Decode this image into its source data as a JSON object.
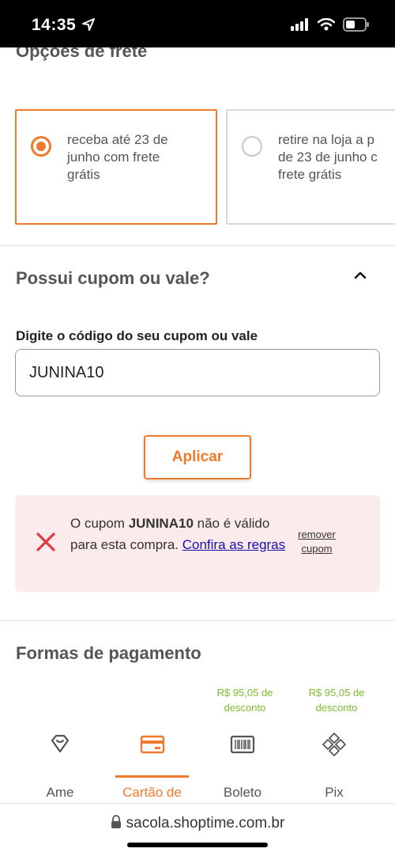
{
  "status_bar": {
    "time": "14:35"
  },
  "shipping": {
    "title": "Opções de frete",
    "options": [
      {
        "text": "receba até 23 de\njunho com frete\ngrátis",
        "selected": true
      },
      {
        "text": "retire na loja a p\nde 23 de junho c\nfrete grátis",
        "selected": false
      }
    ]
  },
  "coupon": {
    "title": "Possui cupom ou vale?",
    "label": "Digite o código do seu cupom ou vale",
    "value": "JUNINA10",
    "apply_label": "Aplicar",
    "error": {
      "prefix": "O cupom ",
      "code": "JUNINA10",
      "suffix": " não é válido para esta compra. ",
      "link": "Confira as regras",
      "remove_label": "remover cupom"
    }
  },
  "payment": {
    "title": "Formas de pagamento",
    "discounts": [
      "R$ 95,05 de desconto",
      "R$ 95,05 de desconto"
    ],
    "tabs": [
      {
        "label": "Ame",
        "icon": "ame-icon",
        "active": false
      },
      {
        "label": "Cartão de",
        "icon": "credit-card-icon",
        "active": true
      },
      {
        "label": "Boleto",
        "icon": "barcode-icon",
        "active": false
      },
      {
        "label": "Pix",
        "icon": "pix-icon",
        "active": false
      }
    ]
  },
  "browser": {
    "url": "sacola.shoptime.com.br"
  },
  "colors": {
    "accent": "#f07a2c",
    "error_bg": "#fcebec",
    "error_icon": "#e0393e",
    "discount": "#7cbb2f",
    "link": "#1a0dab"
  }
}
